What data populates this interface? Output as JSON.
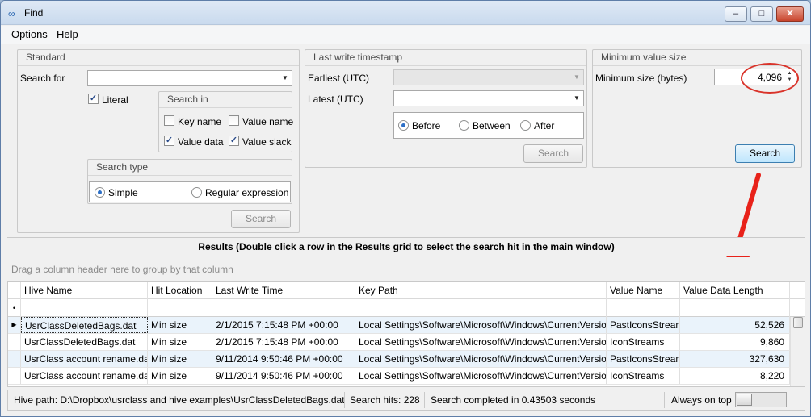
{
  "window": {
    "title": "Find"
  },
  "menu": {
    "items": [
      "Options",
      "Help"
    ]
  },
  "standard": {
    "title": "Standard",
    "search_for_label": "Search for",
    "search_for_value": "",
    "literal_label": "Literal",
    "literal_checked": true,
    "search_in": {
      "title": "Search in",
      "key_name": "Key name",
      "value_name": "Value name",
      "value_data": "Value data",
      "value_slack": "Value slack",
      "key_name_checked": false,
      "value_name_checked": false,
      "value_data_checked": true,
      "value_slack_checked": true
    },
    "search_type": {
      "title": "Search type",
      "simple": "Simple",
      "regex": "Regular expression",
      "selected": "Simple"
    },
    "search_button": "Search"
  },
  "timestamp": {
    "title": "Last write timestamp",
    "earliest_label": "Earliest (UTC)",
    "latest_label": "Latest (UTC)",
    "before": "Before",
    "between": "Between",
    "after": "After",
    "selected": "Before",
    "search_button": "Search"
  },
  "minsize": {
    "title": "Minimum value size",
    "label": "Minimum size (bytes)",
    "value": "4,096",
    "search_button": "Search"
  },
  "results": {
    "header": "Results (Double click a row in the Results grid to select the search hit in the main window)",
    "group_hint": "Drag a column header here to group by that column",
    "columns": [
      "Hive Name",
      "Hit Location",
      "Last Write Time",
      "Key Path",
      "Value Name",
      "Value Data Length"
    ],
    "rows": [
      [
        "UsrClassDeletedBags.dat",
        "Min size",
        "2/1/2015 7:15:48 PM +00:00",
        "Local Settings\\Software\\Microsoft\\Windows\\CurrentVersion...",
        "PastIconsStream",
        "52,526"
      ],
      [
        "UsrClassDeletedBags.dat",
        "Min size",
        "2/1/2015 7:15:48 PM +00:00",
        "Local Settings\\Software\\Microsoft\\Windows\\CurrentVersion...",
        "IconStreams",
        "9,860"
      ],
      [
        "UsrClass account rename.dat",
        "Min size",
        "9/11/2014 9:50:46 PM +00:00",
        "Local Settings\\Software\\Microsoft\\Windows\\CurrentVersion...",
        "PastIconsStream",
        "327,630"
      ],
      [
        "UsrClass account rename.dat",
        "Min size",
        "9/11/2014 9:50:46 PM +00:00",
        "Local Settings\\Software\\Microsoft\\Windows\\CurrentVersion...",
        "IconStreams",
        "8,220"
      ]
    ]
  },
  "status": {
    "hive_path": "Hive path: D:\\Dropbox\\usrclass and hive examples\\UsrClassDeletedBags.dat",
    "search_hits": "Search hits: 228",
    "completed": "Search completed in 0.43503 seconds",
    "always_on_top": "Always on top"
  },
  "colors": {
    "annotation": "#d9332a",
    "accent": "#2d6fc6"
  }
}
